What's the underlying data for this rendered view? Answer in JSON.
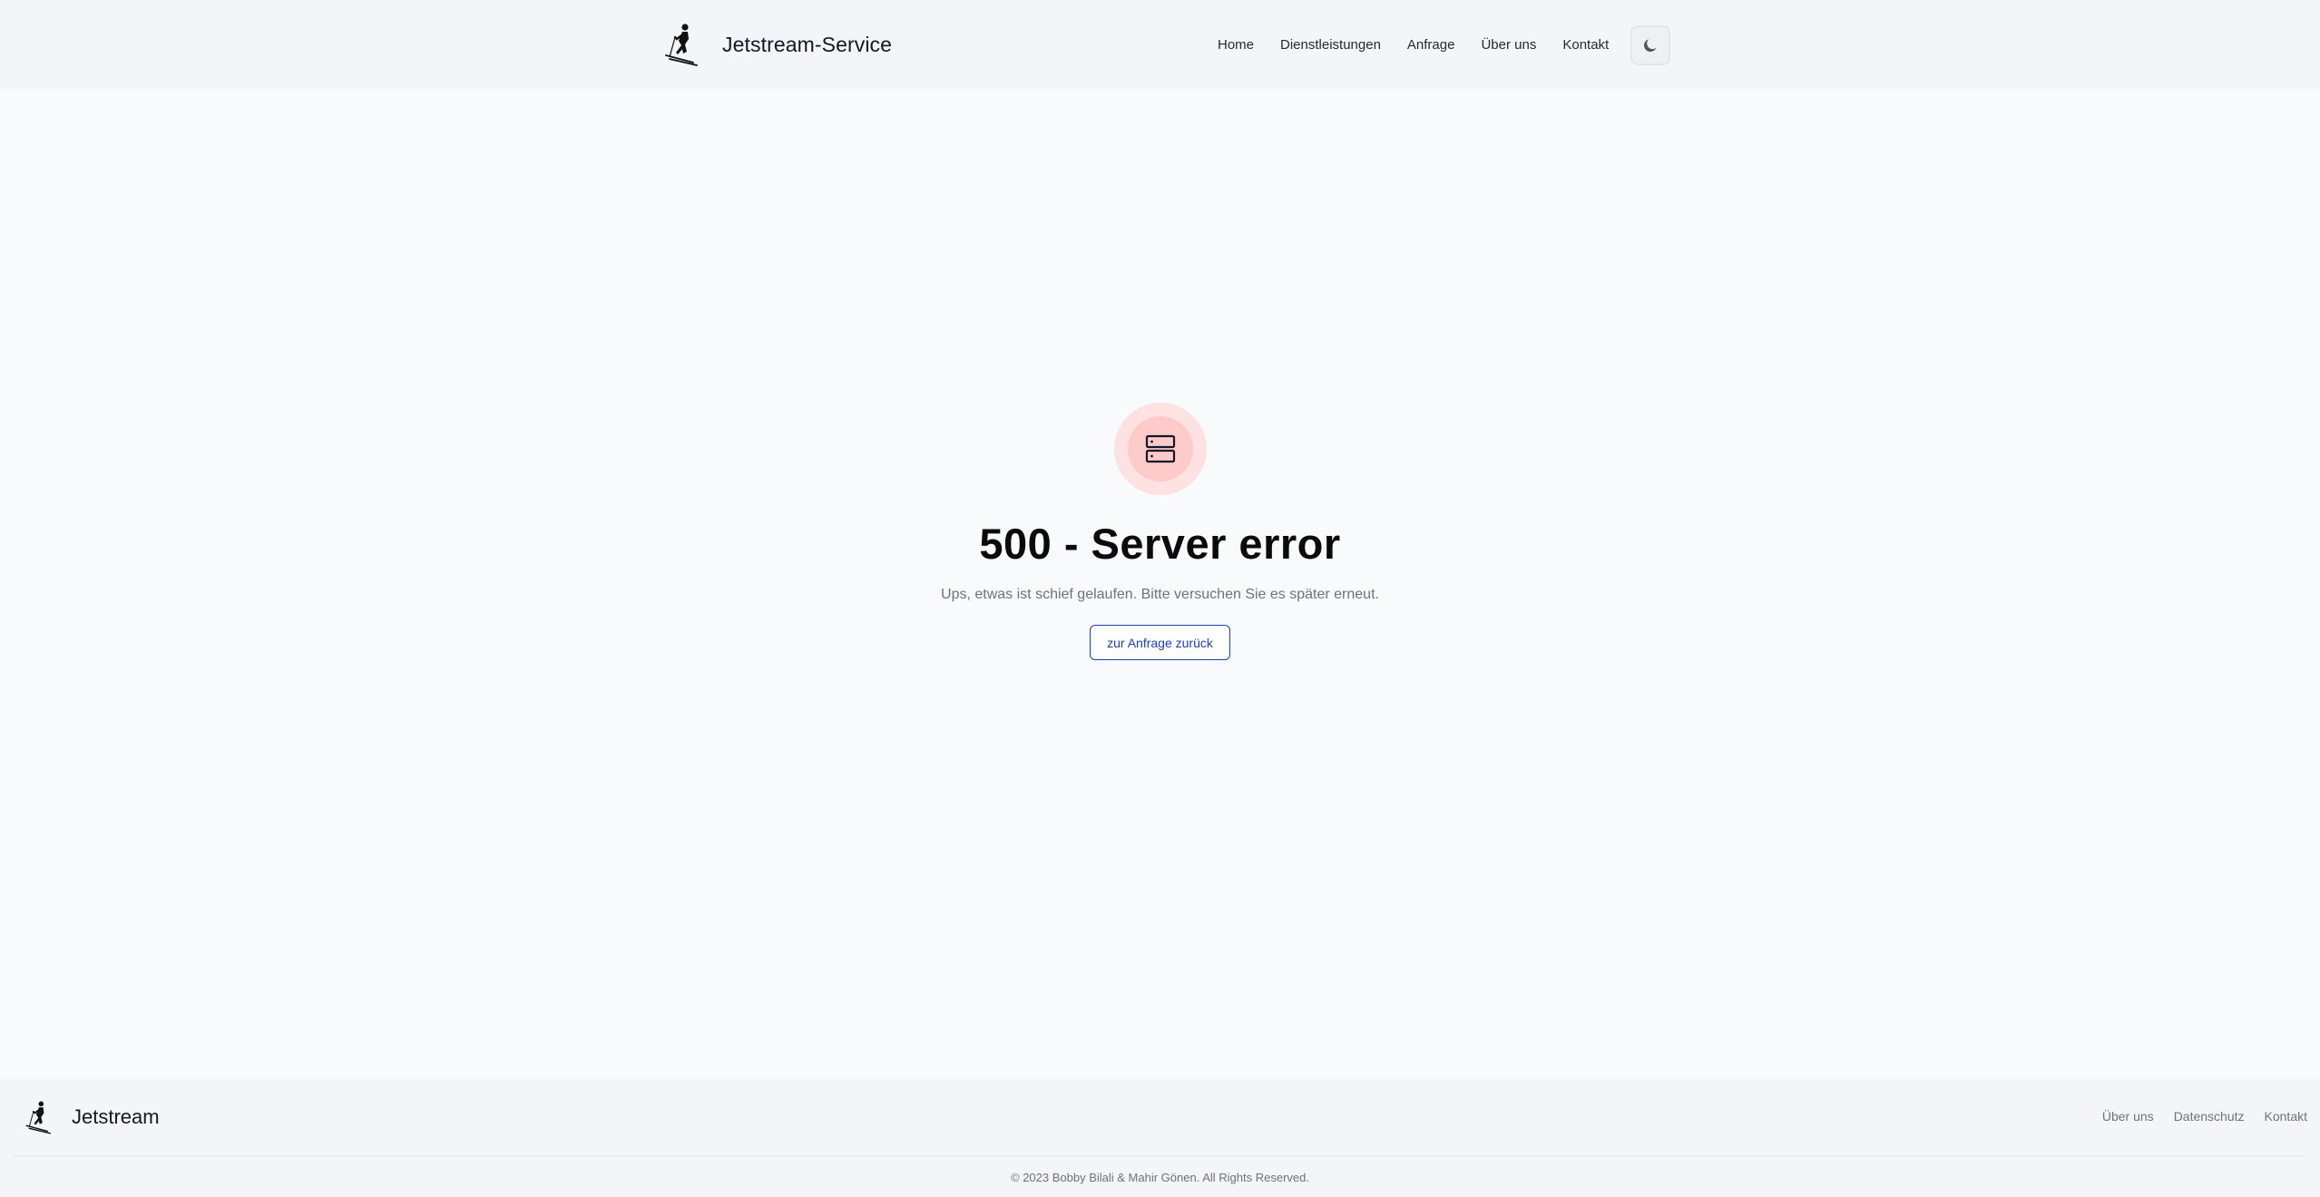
{
  "header": {
    "brand_name": "Jetstream-Service",
    "nav": [
      {
        "label": "Home"
      },
      {
        "label": "Dienstleistungen"
      },
      {
        "label": "Anfrage"
      },
      {
        "label": "Über uns"
      },
      {
        "label": "Kontakt"
      }
    ],
    "theme_toggle_icon": "moon-icon",
    "logo_icon": "skier-icon"
  },
  "main": {
    "icon": "server-icon",
    "title": "500 - Server error",
    "message": "Ups, etwas ist schief gelaufen. Bitte versuchen Sie es später erneut.",
    "button_label": "zur Anfrage zurück"
  },
  "footer": {
    "brand_name": "Jetstream",
    "links": [
      {
        "label": "Über uns"
      },
      {
        "label": "Datenschutz"
      },
      {
        "label": "Kontakt"
      }
    ],
    "copyright": "© 2023 Bobby Bilali & Mahir Gönen. All Rights Reserved."
  },
  "colors": {
    "accent": "#1e40af",
    "error_ring_outer": "#fee2e2",
    "error_ring_inner": "#fecaca",
    "header_bg": "#f3f5f8",
    "page_bg": "#f9fafb"
  }
}
